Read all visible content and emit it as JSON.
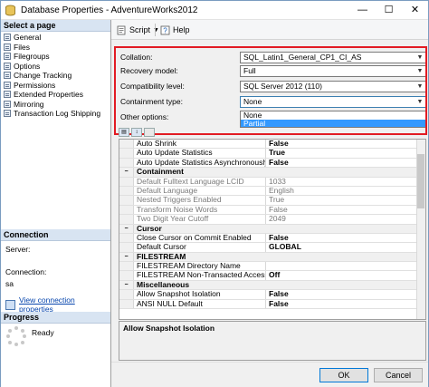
{
  "window": {
    "title": "Database Properties - AdventureWorks2012",
    "min_glyph": "—",
    "max_glyph": "☐",
    "close_glyph": "✕"
  },
  "left_panel": {
    "select_page_header": "Select a page",
    "pages": [
      "General",
      "Files",
      "Filegroups",
      "Options",
      "Change Tracking",
      "Permissions",
      "Extended Properties",
      "Mirroring",
      "Transaction Log Shipping"
    ],
    "connection_header": "Connection",
    "server_label": "Server:",
    "server_value": "",
    "connection_label": "Connection:",
    "connection_value": "sa",
    "view_connection_link": "View connection properties",
    "progress_header": "Progress",
    "progress_status": "Ready"
  },
  "toolbar": {
    "script_label": "Script",
    "help_label": "Help"
  },
  "options": {
    "collation_label": "Collation:",
    "collation_value": "SQL_Latin1_General_CP1_CI_AS",
    "recovery_label": "Recovery model:",
    "recovery_value": "Full",
    "compat_label": "Compatibility level:",
    "compat_value": "SQL Server 2012 (110)",
    "containment_label": "Containment type:",
    "containment_value": "None",
    "containment_options": [
      "None",
      "Partial"
    ],
    "containment_selected_option": "Partial",
    "other_options_label": "Other options:"
  },
  "grid": {
    "rows": [
      {
        "type": "prop",
        "name": "Auto Shrink",
        "value": "False",
        "style": "bold"
      },
      {
        "type": "prop",
        "name": "Auto Update Statistics",
        "value": "True",
        "style": "bold"
      },
      {
        "type": "prop",
        "name": "Auto Update Statistics Asynchronously",
        "value": "False",
        "style": "bold"
      },
      {
        "type": "cat",
        "name": "Containment"
      },
      {
        "type": "prop",
        "name": "Default Fulltext Language LCID",
        "value": "1033",
        "style": "dis"
      },
      {
        "type": "prop",
        "name": "Default Language",
        "value": "English",
        "style": "dis"
      },
      {
        "type": "prop",
        "name": "Nested Triggers Enabled",
        "value": "True",
        "style": "dis"
      },
      {
        "type": "prop",
        "name": "Transform Noise Words",
        "value": "False",
        "style": "dis"
      },
      {
        "type": "prop",
        "name": "Two Digit Year Cutoff",
        "value": "2049",
        "style": "dis"
      },
      {
        "type": "cat",
        "name": "Cursor"
      },
      {
        "type": "prop",
        "name": "Close Cursor on Commit Enabled",
        "value": "False",
        "style": "bold"
      },
      {
        "type": "prop",
        "name": "Default Cursor",
        "value": "GLOBAL",
        "style": "bold"
      },
      {
        "type": "cat",
        "name": "FILESTREAM"
      },
      {
        "type": "prop",
        "name": "FILESTREAM Directory Name",
        "value": "",
        "style": "bold"
      },
      {
        "type": "prop",
        "name": "FILESTREAM Non-Transacted Access",
        "value": "Off",
        "style": "bold"
      },
      {
        "type": "cat",
        "name": "Miscellaneous"
      },
      {
        "type": "prop",
        "name": "Allow Snapshot Isolation",
        "value": "False",
        "style": "bold"
      },
      {
        "type": "prop",
        "name": "ANSI NULL Default",
        "value": "False",
        "style": "bold"
      }
    ],
    "collapse_glyph": "−"
  },
  "description": {
    "title": "Allow Snapshot Isolation"
  },
  "footer": {
    "ok_label": "OK",
    "cancel_label": "Cancel"
  },
  "colors": {
    "highlight_border": "#e21b23",
    "selection": "#3399ff",
    "link": "#0645ad"
  }
}
